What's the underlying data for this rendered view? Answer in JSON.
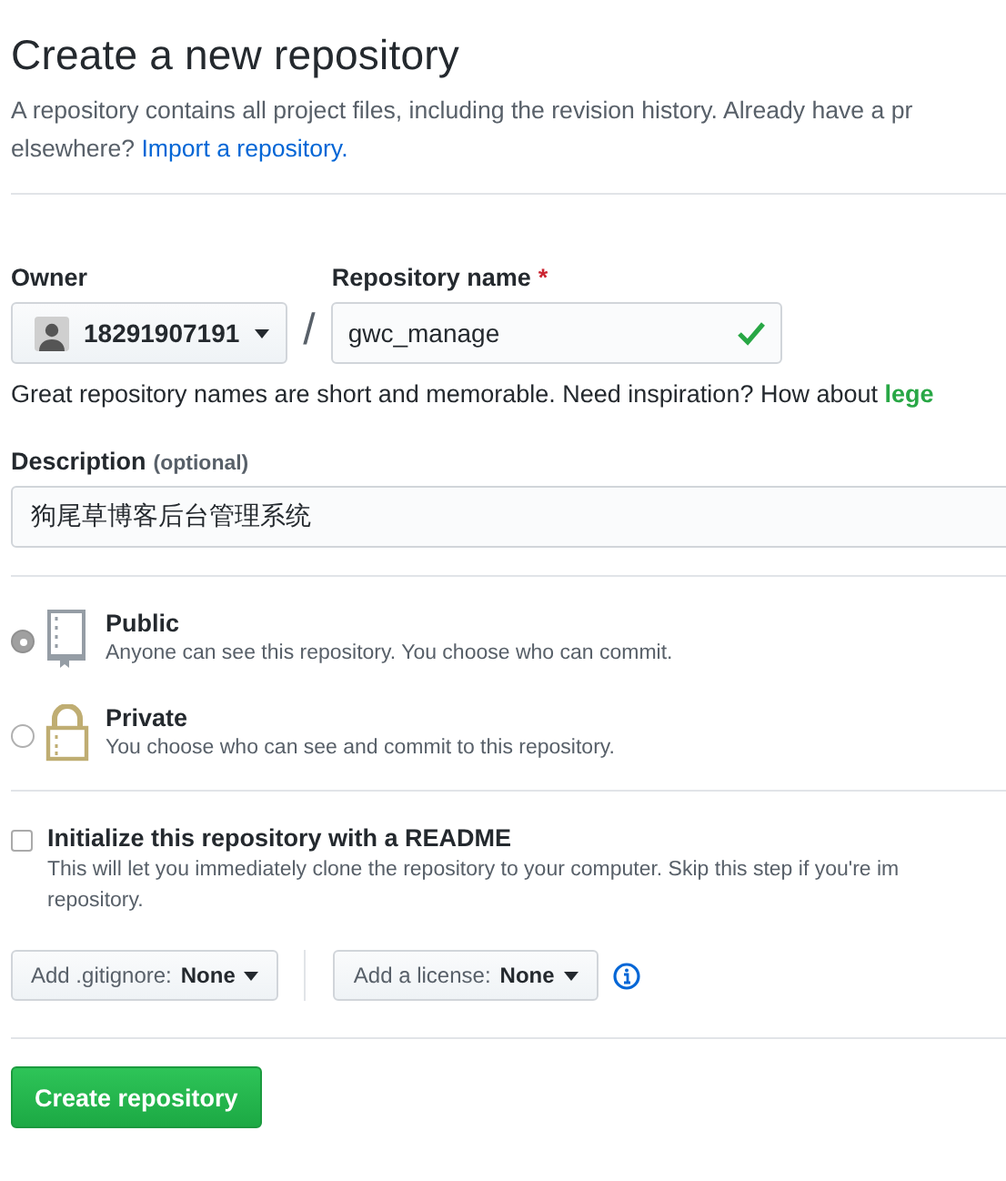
{
  "title": "Create a new repository",
  "intro": {
    "text": "A repository contains all project files, including the revision history. Already have a pr",
    "text_2": "elsewhere?",
    "link": "Import a repository."
  },
  "owner": {
    "label": "Owner",
    "value": "18291907191"
  },
  "separator": "/",
  "repo_name": {
    "label": "Repository name",
    "required_mark": "*",
    "value": "gwc_manage",
    "valid": true
  },
  "hint": {
    "text": "Great repository names are short and memorable. Need inspiration? How about",
    "suggestion": "lege"
  },
  "description": {
    "label": "Description",
    "note": "(optional)",
    "value": "狗尾草博客后台管理系统"
  },
  "visibility": [
    {
      "kind": "public",
      "title": "Public",
      "text": "Anyone can see this repository. You choose who can commit.",
      "selected": true
    },
    {
      "kind": "private",
      "title": "Private",
      "text": "You choose who can see and commit to this repository.",
      "selected": false
    }
  ],
  "readme": {
    "label": "Initialize this repository with a README",
    "text": "This will let you immediately clone the repository to your computer. Skip this step if you're im",
    "text_2": "repository.",
    "checked": false
  },
  "gitignore": {
    "label": "Add .gitignore:",
    "value": "None"
  },
  "license": {
    "label": "Add a license:",
    "value": "None"
  },
  "submit": "Create repository"
}
